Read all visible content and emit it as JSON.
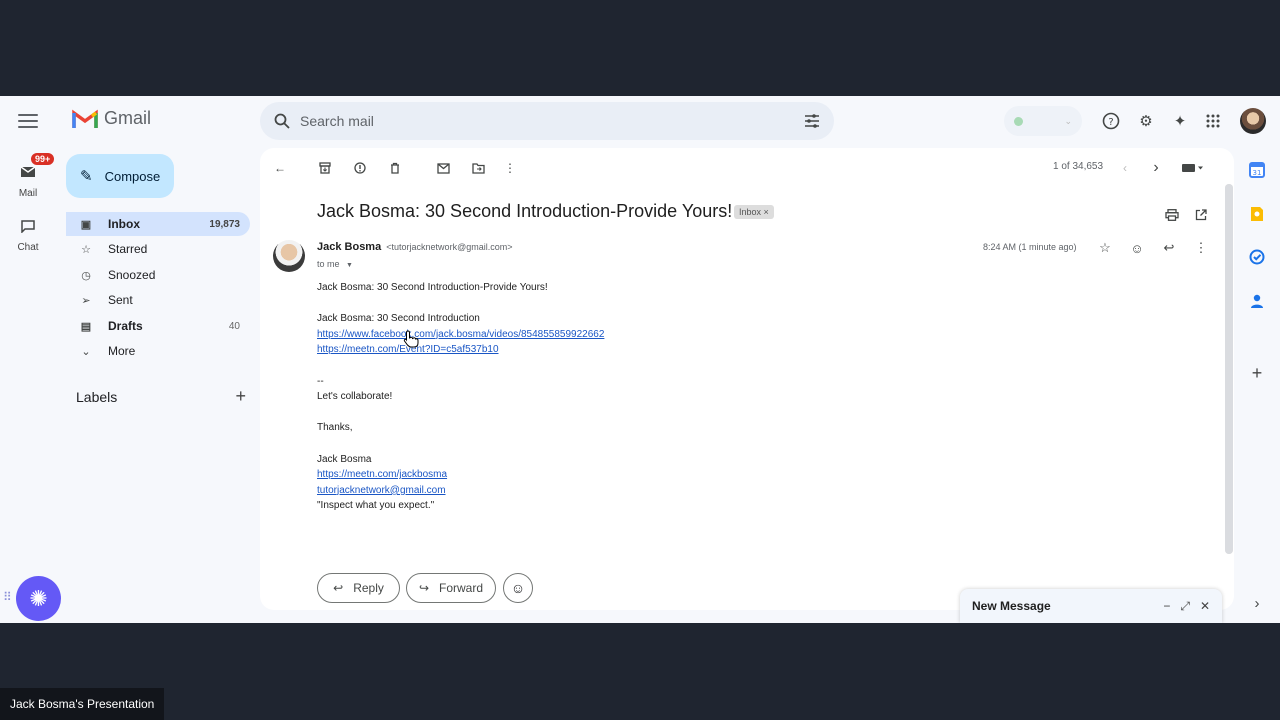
{
  "app": {
    "name": "Gmail"
  },
  "rail": {
    "mail_label": "Mail",
    "mail_badge": "99+",
    "chat_label": "Chat"
  },
  "nav": {
    "compose": "Compose",
    "items": [
      {
        "label": "Inbox",
        "count": "19,873",
        "icon": "inbox-icon",
        "active": true
      },
      {
        "label": "Starred",
        "count": "",
        "icon": "star-icon"
      },
      {
        "label": "Snoozed",
        "count": "",
        "icon": "clock-icon"
      },
      {
        "label": "Sent",
        "count": "",
        "icon": "send-icon"
      },
      {
        "label": "Drafts",
        "count": "40",
        "icon": "draft-icon"
      },
      {
        "label": "More",
        "count": "",
        "icon": "chevron-down-icon"
      }
    ],
    "labels_heading": "Labels"
  },
  "search": {
    "placeholder": "Search mail"
  },
  "toolbar": {
    "pager": "1 of 34,653"
  },
  "email": {
    "subject": "Jack Bosma: 30 Second Introduction-Provide Yours!",
    "tag": "Inbox ×",
    "sender_name": "Jack Bosma",
    "sender_email": "<tutorjacknetwork@gmail.com>",
    "to": "to me",
    "time": "8:24 AM (1 minute ago)",
    "body": {
      "line1": "Jack Bosma: 30 Second Introduction-Provide Yours!",
      "line2": "Jack Bosma: 30 Second Introduction",
      "link1": "https://www.facebook.com/jack.bosma/videos/854855859922662",
      "link2": "https://meetn.com/Event?ID=c5af537b10",
      "sep": "--",
      "collab": "Let's collaborate!",
      "thanks": "Thanks,",
      "sig_name": "Jack Bosma",
      "sig_link": "https://meetn.com/jackbosma",
      "sig_email": "tutorjacknetwork@gmail.com",
      "quote": "\"Inspect what you expect.\""
    }
  },
  "actions": {
    "reply": "Reply",
    "forward": "Forward"
  },
  "new_message": {
    "title": "New Message"
  },
  "presentation": {
    "label": "Jack Bosma's Presentation"
  },
  "colors": {
    "accent": "#c2e7ff",
    "active_nav": "#d3e3fd",
    "link": "#1a56c5",
    "fab": "#6459f6"
  }
}
